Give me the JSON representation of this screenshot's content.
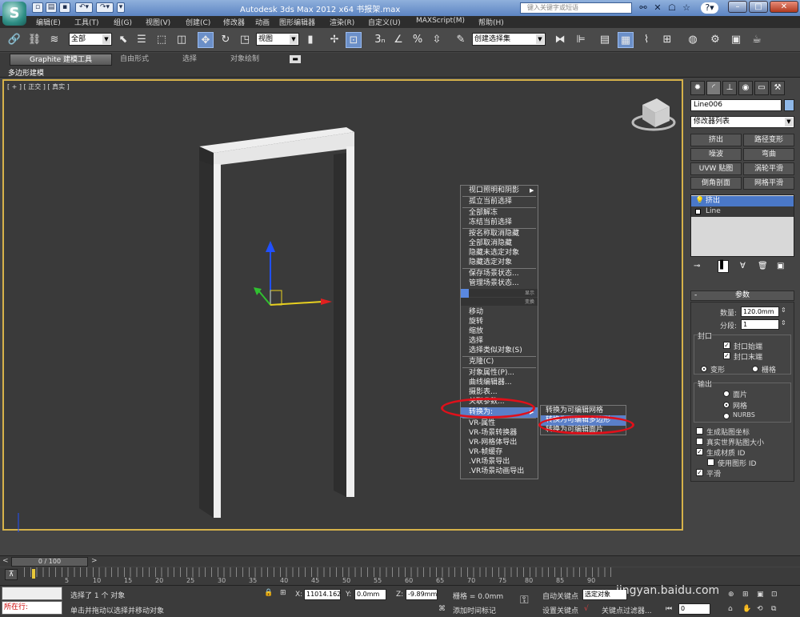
{
  "window": {
    "title": "Autodesk 3ds Max  2012 x64      书报架.max",
    "search_placeholder": "键入关键字或短语",
    "minimize": "–",
    "maximize": "□",
    "close": "✕"
  },
  "menubar": [
    "编辑(E)",
    "工具(T)",
    "组(G)",
    "视图(V)",
    "创建(C)",
    "修改器",
    "动画",
    "图形编辑器",
    "渲染(R)",
    "自定义(U)",
    "MAXScript(M)",
    "帮助(H)"
  ],
  "toolbar": {
    "selection_filter": "全部",
    "ref_coord": "视图",
    "named_selection_sets": "创建选择集"
  },
  "ribbon": {
    "tabs": [
      "Graphite 建模工具",
      "自由形式",
      "选择",
      "对象绘制"
    ],
    "subpanel": "多边形建模"
  },
  "viewport": {
    "label": "[ + ] [ 正交 ] [ 真实 ]"
  },
  "context_menu": {
    "left_items": [
      "视口照明和阴影",
      "孤立当前选择",
      "全部解冻",
      "冻结当前选择",
      "按名称取消隐藏",
      "全部取消隐藏",
      "隐藏未选定对象",
      "隐藏选定对象",
      "保存场景状态...",
      "管理场景状态...",
      "显示",
      "变换",
      "移动",
      "旋转",
      "缩放",
      "选择",
      "选择类似对象(S)",
      "克隆(C)",
      "对象属性(P)...",
      "曲线编辑器...",
      "摄影表...",
      "关联参数...",
      "转换为:",
      "VR-属性",
      "VR-场景转换器",
      "VR-网格体导出",
      "VR-帧缓存",
      ".VR场景导出",
      ".VR场景动画导出"
    ],
    "submenu": [
      "转换为可编辑网格",
      "转换为可编辑多边形",
      "转换为可编辑面片"
    ]
  },
  "command_panel": {
    "object_name": "Line006",
    "modifier_list": "修改器列表",
    "modifier_buttons": [
      "挤出",
      "路径变形",
      "噪波",
      "弯曲",
      "UVW 贴图",
      "涡轮平滑",
      "倒角剖面",
      "网格平滑"
    ],
    "stack": [
      "挤出",
      "Line"
    ],
    "params_title": "参数",
    "amount_label": "数量:",
    "amount_value": "120.0mm",
    "segments_label": "分段:",
    "segments_value": "1",
    "capping_label": "封口",
    "cap_start": "封口始端",
    "cap_end": "封口末端",
    "morph": "变形",
    "grid": "栅格",
    "output_label": "输出",
    "patch": "面片",
    "mesh": "网格",
    "nurbs": "NURBS",
    "gen_map_coords": "生成贴图坐标",
    "real_world": "真实世界贴图大小",
    "gen_mat_ids": "生成材质 ID",
    "use_shape_ids": "使用图形 ID",
    "smooth": "平滑"
  },
  "timeline": {
    "frame": "0 / 100",
    "ticks": [
      "5",
      "10",
      "15",
      "20",
      "25",
      "30",
      "35",
      "40",
      "45",
      "50",
      "55",
      "60",
      "65",
      "70",
      "75",
      "80",
      "85",
      "90"
    ]
  },
  "status": {
    "listener": "所在行:",
    "selected": "选择了 1 个 对象",
    "prompt": "单击并拖动以选择并移动对象",
    "x_label": "X:",
    "x_value": "11014.162",
    "y_label": "Y:",
    "y_value": "0.0mm",
    "z_label": "Z:",
    "z_value": "-9.89mm",
    "grid": "栅格 = 0.0mm",
    "add_time_tag": "添加时间标记",
    "auto_key": "自动关键点",
    "selected_btn": "选定对象",
    "set_key": "设置关键点",
    "key_filters": "关键点过滤器...",
    "frame_field": "0",
    "watermark": "jingyan.baidu.com"
  }
}
